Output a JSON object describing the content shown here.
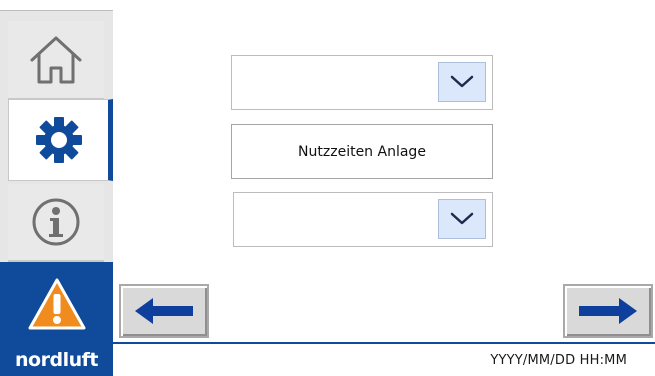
{
  "sidebar": {
    "home_icon": "home-icon",
    "settings_icon": "gear-icon",
    "info_icon": "info-icon",
    "alarm_icon": "warning-icon",
    "brand": "nordluft"
  },
  "main": {
    "dropdown_top": {
      "value": ""
    },
    "button_label": "Nutzzeiten Anlage",
    "dropdown_bottom": {
      "value": ""
    }
  },
  "nav": {
    "prev_icon": "arrow-left-icon",
    "next_icon": "arrow-right-icon"
  },
  "status": {
    "datetime": "YYYY/MM/DD HH:MM"
  },
  "colors": {
    "primary": "#0f4b9a",
    "alarm": "#f08c1e",
    "dropdown_button": "#dbe7fb"
  }
}
